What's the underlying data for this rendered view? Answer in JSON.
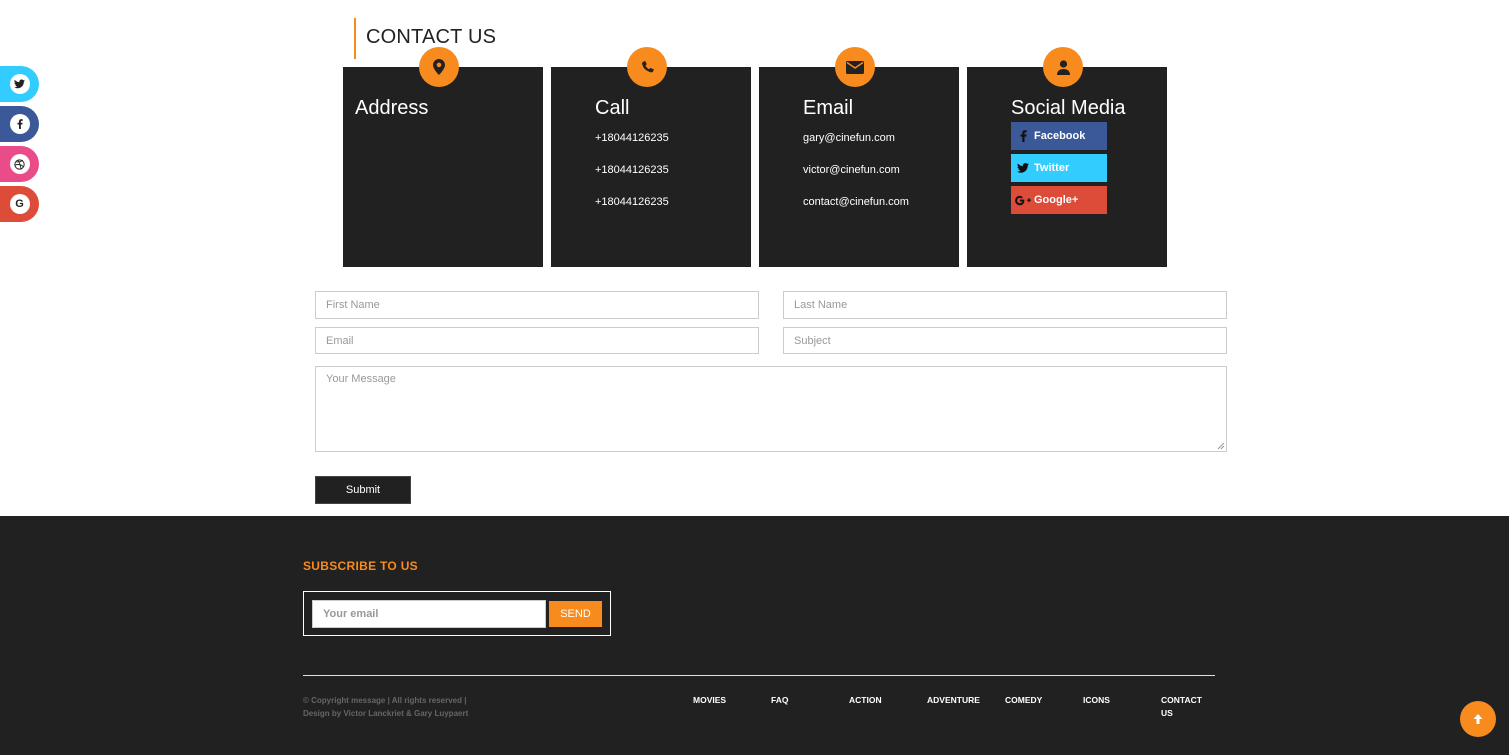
{
  "rail": {
    "items": [
      {
        "name": "twitter",
        "icon": "twitter-icon",
        "color": "#33ccff"
      },
      {
        "name": "facebook",
        "icon": "facebook-icon",
        "color": "#3b5998"
      },
      {
        "name": "dribbble",
        "icon": "dribbble-icon",
        "color": "#ea4c89"
      },
      {
        "name": "google",
        "icon": "google-icon",
        "glyph": "G",
        "color": "#dd4b39"
      }
    ]
  },
  "heading": "CONTACT US",
  "accent": "#f88b1e",
  "cards": {
    "address": {
      "title": "Address",
      "icon": "map-marker-icon"
    },
    "call": {
      "title": "Call",
      "icon": "phone-icon",
      "lines": [
        "+18044126235",
        "+18044126235",
        "+18044126235"
      ]
    },
    "email": {
      "title": "Email",
      "icon": "envelope-icon",
      "lines": [
        "gary@cinefun.com",
        "victor@cinefun.com",
        "contact@cinefun.com"
      ]
    },
    "social": {
      "title": "Social Media",
      "icon": "user-icon",
      "buttons": [
        {
          "label": "Facebook",
          "icon": "facebook-icon",
          "color": "#3b5998"
        },
        {
          "label": "Twitter",
          "icon": "twitter-icon",
          "color": "#33ccff"
        },
        {
          "label": "Google+",
          "icon": "google-plus-icon",
          "color": "#dd4b39"
        }
      ]
    }
  },
  "form": {
    "first_name_placeholder": "First Name",
    "last_name_placeholder": "Last Name",
    "email_placeholder": "Email",
    "subject_placeholder": "Subject",
    "message_placeholder": "Your Message",
    "submit_label": "Submit"
  },
  "footer": {
    "subscribe_title": "SUBSCRIBE TO US",
    "email_placeholder": "Your email",
    "send_label": "SEND",
    "copyright_line1": "© Copyright message | All rights reserved |",
    "copyright_line2": "Design by Victor Lanckriet & Gary Luypaert",
    "nav": [
      "MOVIES",
      "FAQ",
      "ACTION",
      "ADVENTURE",
      "COMEDY",
      "ICONS",
      "CONTACT US"
    ]
  },
  "back_to_top": {
    "icon": "arrow-up-icon"
  }
}
